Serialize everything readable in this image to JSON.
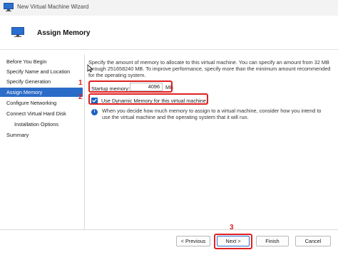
{
  "window": {
    "title": "New Virtual Machine Wizard"
  },
  "header": {
    "title": "Assign Memory"
  },
  "sidebar": {
    "items": [
      {
        "label": "Before You Begin"
      },
      {
        "label": "Specify Name and Location"
      },
      {
        "label": "Specify Generation"
      },
      {
        "label": "Assign Memory"
      },
      {
        "label": "Configure Networking"
      },
      {
        "label": "Connect Virtual Hard Disk"
      },
      {
        "label": "Installation Options"
      },
      {
        "label": "Summary"
      }
    ]
  },
  "main": {
    "description": "Specify the amount of memory to allocate to this virtual machine. You can specify an amount from 32 MB through 251658240 MB. To improve performance, specify more than the minimum amount recommended for the operating system.",
    "startup_memory_label": "Startup memory:",
    "startup_memory_value": "4096",
    "startup_memory_unit": "MB",
    "dynamic_memory_label": "Use Dynamic Memory for this virtual machine.",
    "dynamic_memory_checked": true,
    "info_text": "When you decide how much memory to assign to a virtual machine, consider how you intend to use the virtual machine and the operating system that it will run."
  },
  "annotations": {
    "one": "1",
    "two": "2",
    "three": "3"
  },
  "buttons": {
    "previous": "< Previous",
    "next": "Next >",
    "finish": "Finish",
    "cancel": "Cancel"
  },
  "colors": {
    "accent": "#2b6cc8",
    "highlight": "#e02020"
  }
}
